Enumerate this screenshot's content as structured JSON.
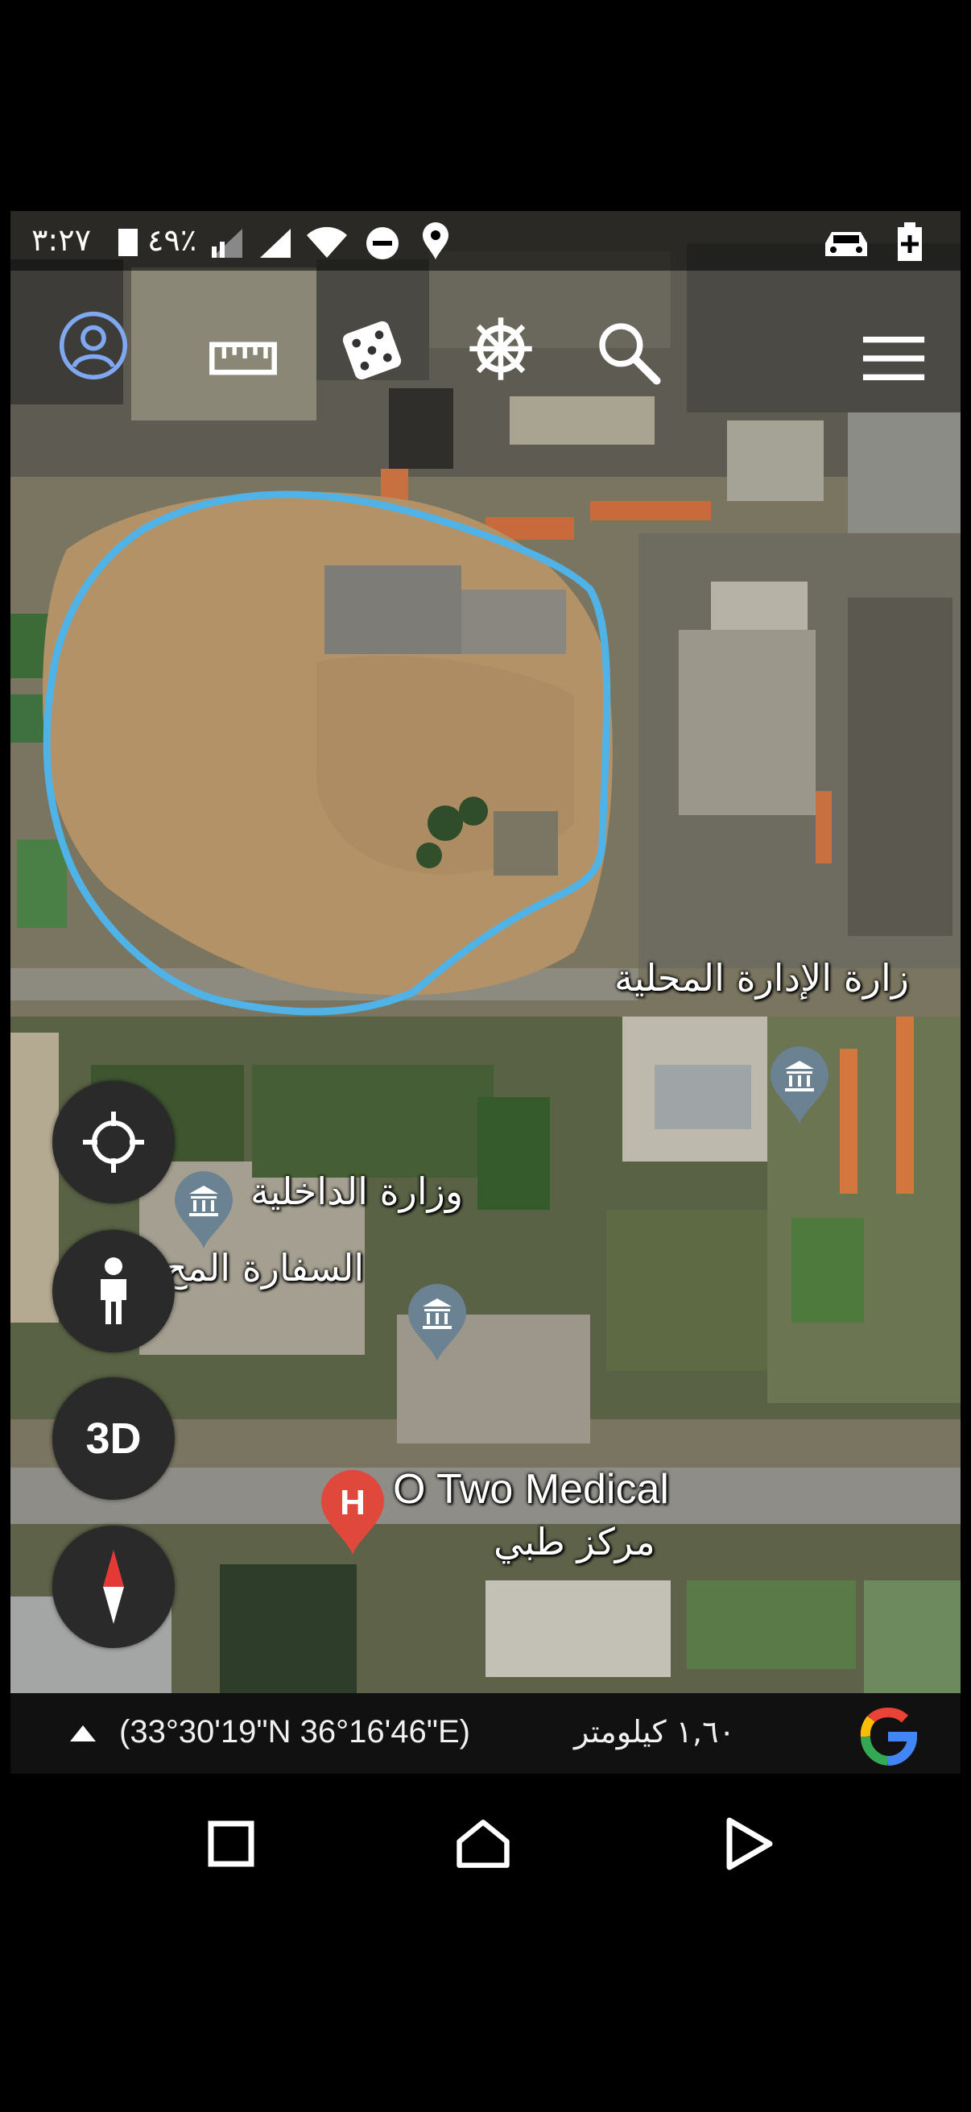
{
  "status_bar": {
    "time": "٣:٢٧",
    "battery_percent": "٤٩٪"
  },
  "toolbar": {
    "icons": [
      "profile-icon",
      "ruler-icon",
      "dice-icon",
      "ship-wheel-icon",
      "search-icon",
      "menu-icon"
    ],
    "accent_color": "#7fa8f0"
  },
  "map": {
    "highlight_color": "#4fb3e8",
    "labels": {
      "ministry_local_admin": "زارة الإدارة المحلية",
      "ministry_interior": "وزارة الداخلية",
      "embassy": "السفارة المح",
      "medical_name": "O Two Medical",
      "medical_type": "مركز طبي"
    }
  },
  "controls": {
    "btn_3d": "3D"
  },
  "info_bar": {
    "coordinates": "(33°30'19\"N 36°16'46\"E)",
    "scale": "١,٦٠ كيلومتر",
    "logo": "G"
  },
  "nav_bar": {
    "icons": [
      "recents-icon",
      "home-icon",
      "back-icon"
    ]
  }
}
